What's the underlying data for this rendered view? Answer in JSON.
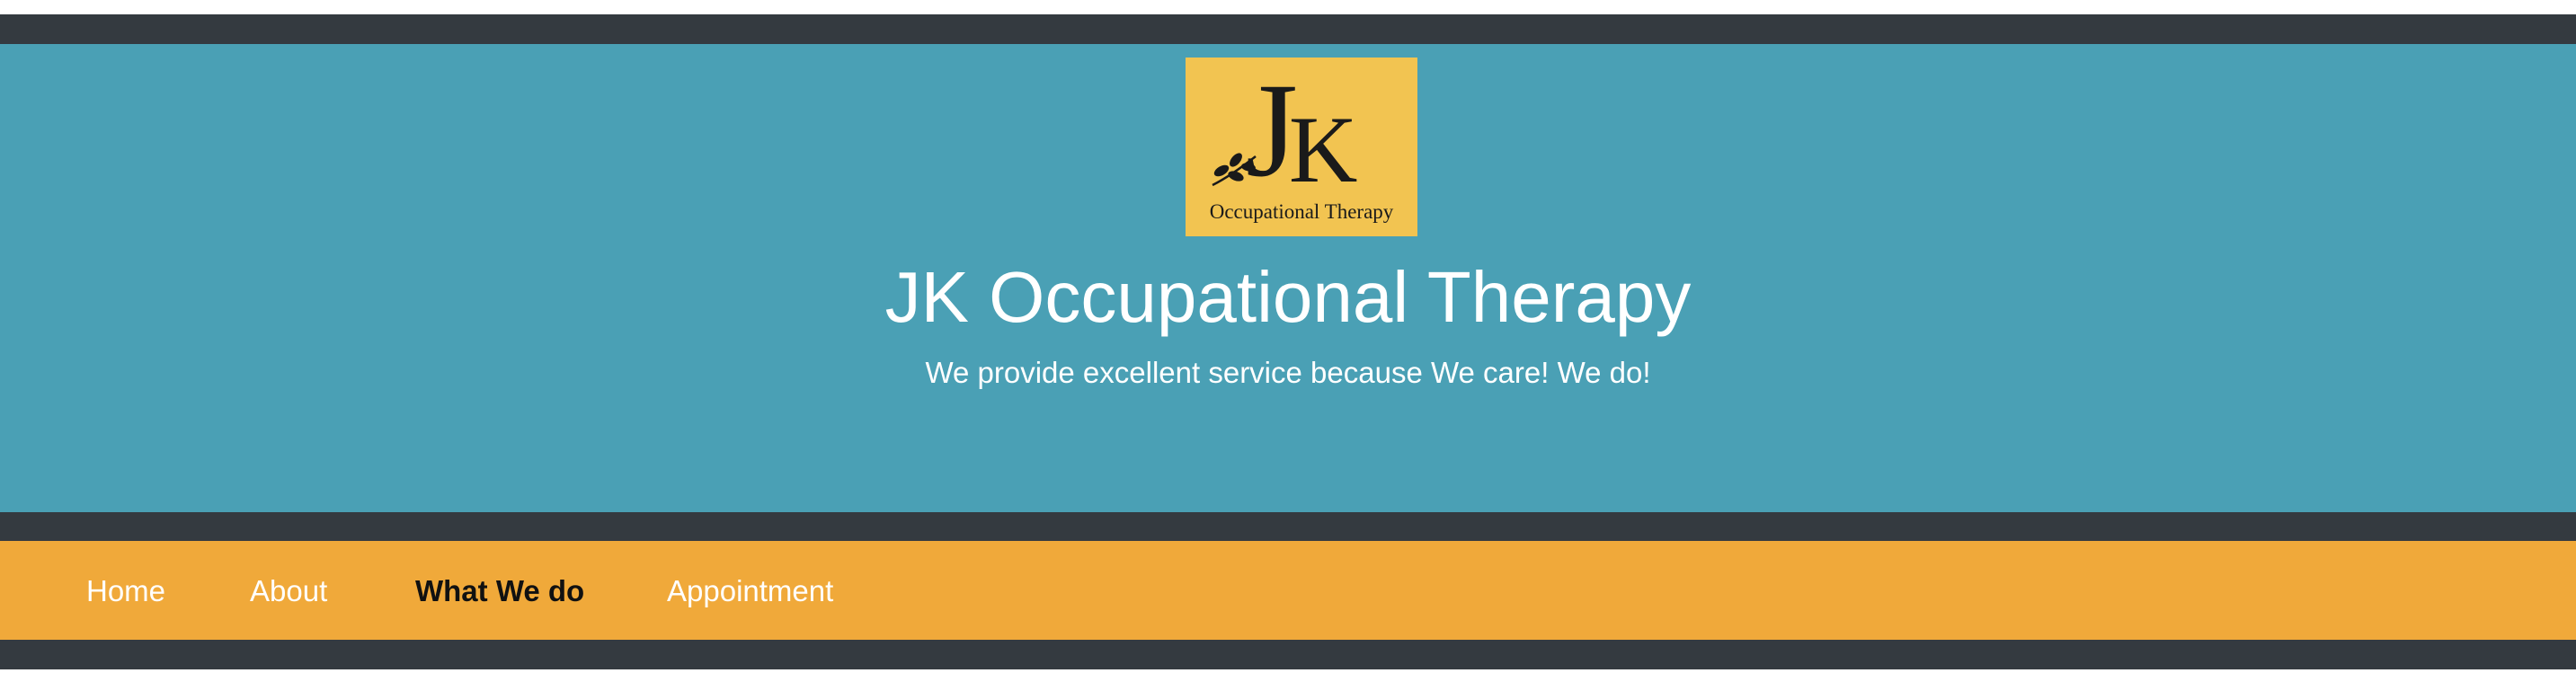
{
  "logo": {
    "letter_j": "J",
    "letter_k": "K",
    "subtitle": "Occupational Therapy",
    "background": "#f2c451",
    "icon": "leaf-branch-icon"
  },
  "hero": {
    "title": "JK Occupational Therapy",
    "tagline": "We provide excellent service because We care! We do!",
    "background": "#4aa0b5"
  },
  "nav": {
    "background": "#f0a93a",
    "items": [
      {
        "label": "Home",
        "active": false
      },
      {
        "label": "About",
        "active": false
      },
      {
        "label": "What We do",
        "active": true
      },
      {
        "label": "Appointment",
        "active": false
      }
    ]
  },
  "colors": {
    "dark_bar": "#343a40",
    "text_light": "#ffffff",
    "text_active": "#111111"
  }
}
